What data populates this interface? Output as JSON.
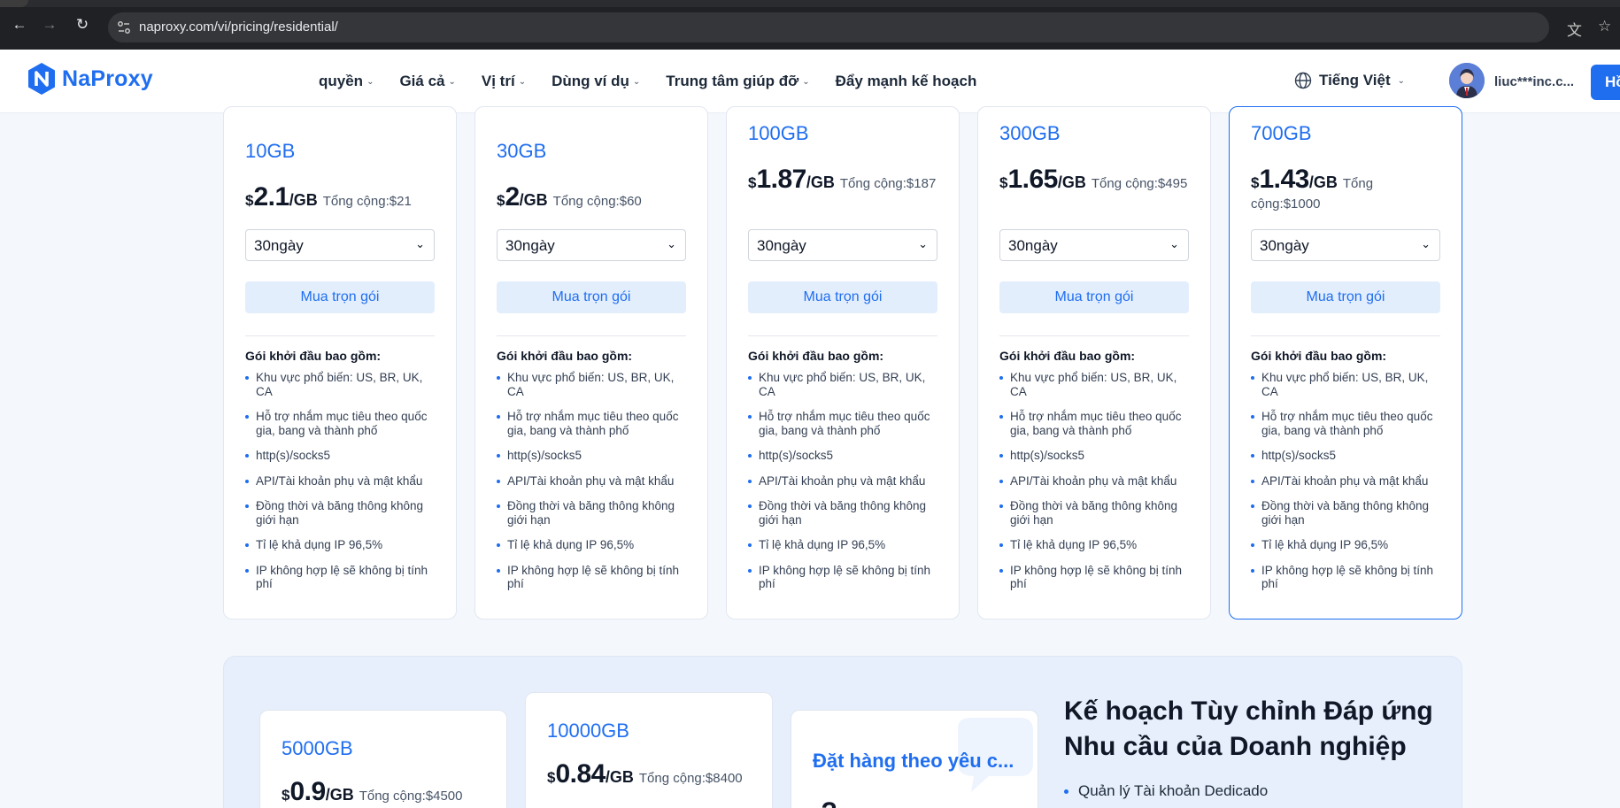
{
  "browser": {
    "url": "naproxy.com/vi/pricing/residential/"
  },
  "header": {
    "logo_text": "NaProxy",
    "nav": [
      {
        "label": "quyền"
      },
      {
        "label": "Giá cả"
      },
      {
        "label": "Vị trí"
      },
      {
        "label": "Dùng ví dụ"
      },
      {
        "label": "Trung tâm giúp đỡ"
      },
      {
        "label": "Đẩy mạnh kế hoạch"
      }
    ],
    "language": "Tiếng Việt",
    "user": "liuc***inc.c...",
    "cta_label": "Hồ"
  },
  "plans": [
    {
      "gb": "10GB",
      "price": "2.1",
      "unit": "/GB",
      "total": "Tổng cộng:$21",
      "duration": "30ngày",
      "buy_label": "Mua trọn gói"
    },
    {
      "gb": "30GB",
      "price": "2",
      "unit": "/GB",
      "total": "Tổng cộng:$60",
      "duration": "30ngày",
      "buy_label": "Mua trọn gói"
    },
    {
      "gb": "100GB",
      "price": "1.87",
      "unit": "/GB",
      "total": "Tổng cộng:$187",
      "duration": "30ngày",
      "buy_label": "Mua trọn gói"
    },
    {
      "gb": "300GB",
      "price": "1.65",
      "unit": "/GB",
      "total": "Tổng cộng:$495",
      "duration": "30ngày",
      "buy_label": "Mua trọn gói"
    },
    {
      "gb": "700GB",
      "price": "1.43",
      "unit": "/GB",
      "total": "Tổng cộng:$1000",
      "duration": "30ngày",
      "buy_label": "Mua trọn gói"
    }
  ],
  "plan_common": {
    "currency": "$",
    "includes_title": "Gói khởi đầu bao gồm:",
    "features": [
      "Khu vực phổ biến: US, BR, UK, CA",
      "Hỗ trợ nhắm mục tiêu theo quốc gia, bang và thành phố",
      "http(s)/socks5",
      "API/Tài khoản phụ và mật khẩu",
      "Đồng thời và băng thông không giới hạn",
      "Tỉ lệ khả dụng IP 96,5%",
      "IP không hợp lệ sẽ không bị tính phí"
    ]
  },
  "enterprise": {
    "plans": [
      {
        "gb": "5000GB",
        "price": "0.9",
        "unit": "/GB",
        "total": "Tổng cộng:$4500"
      },
      {
        "gb": "10000GB",
        "price": "0.84",
        "unit": "/GB",
        "total": "Tổng cộng:$8400"
      }
    ],
    "custom": {
      "title": "Đặt hàng theo yêu c...",
      "price": "?"
    },
    "heading": "Kế hoạch Tùy chỉnh Đáp ứng Nhu cầu của Doanh nghiệp",
    "features": [
      "Quản lý Tài khoản Dedicado"
    ]
  },
  "colors": {
    "accent": "#1f6ef0",
    "background": "#f4f8fd"
  }
}
